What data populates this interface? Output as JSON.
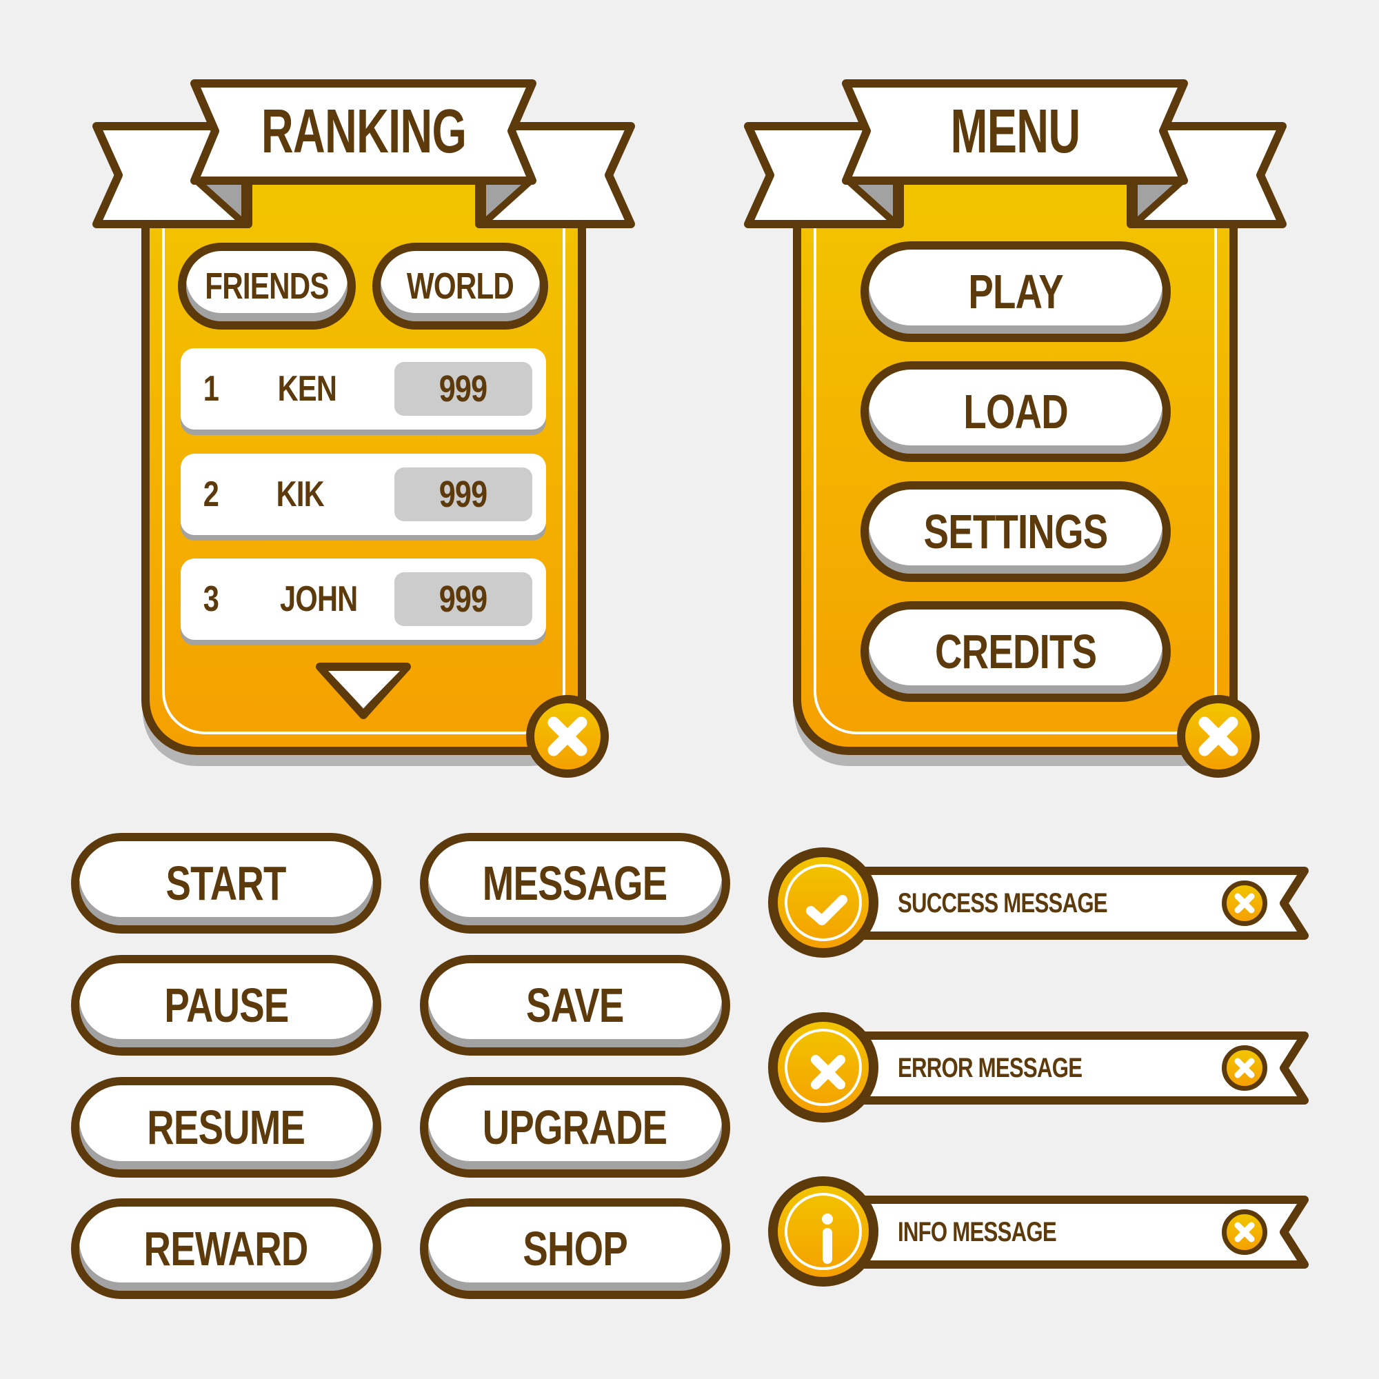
{
  "colors": {
    "outline": "#5c3a0c",
    "panel_top": "#f2c500",
    "panel_bottom": "#f5a000",
    "background": "#f0f0f0",
    "shadow": "#a2a2a2",
    "score_bg": "#cccccc",
    "white": "#ffffff"
  },
  "ranking": {
    "title": "RANKING",
    "tabs": [
      {
        "label": "FRIENDS"
      },
      {
        "label": "WORLD"
      }
    ],
    "rows": [
      {
        "rank": "1",
        "name": "KEN",
        "score": "999"
      },
      {
        "rank": "2",
        "name": "KIK",
        "score": "999"
      },
      {
        "rank": "3",
        "name": "JOHN",
        "score": "999"
      }
    ],
    "scroll_icon": "triangle-down-icon",
    "close_icon": "close-icon"
  },
  "menu": {
    "title": "MENU",
    "buttons": [
      {
        "label": "PLAY"
      },
      {
        "label": "LOAD"
      },
      {
        "label": "SETTINGS"
      },
      {
        "label": "CREDITS"
      }
    ],
    "close_icon": "close-icon"
  },
  "buttons": {
    "left": [
      {
        "label": "START"
      },
      {
        "label": "PAUSE"
      },
      {
        "label": "RESUME"
      },
      {
        "label": "REWARD"
      }
    ],
    "right": [
      {
        "label": "MESSAGE"
      },
      {
        "label": "SAVE"
      },
      {
        "label": "UPGRADE"
      },
      {
        "label": "SHOP"
      }
    ]
  },
  "messages": [
    {
      "type": "success",
      "icon": "check-icon",
      "text": "SUCCESS MESSAGE"
    },
    {
      "type": "error",
      "icon": "x-icon",
      "text": "ERROR MESSAGE"
    },
    {
      "type": "info",
      "icon": "info-icon",
      "text": "INFO MESSAGE"
    }
  ]
}
